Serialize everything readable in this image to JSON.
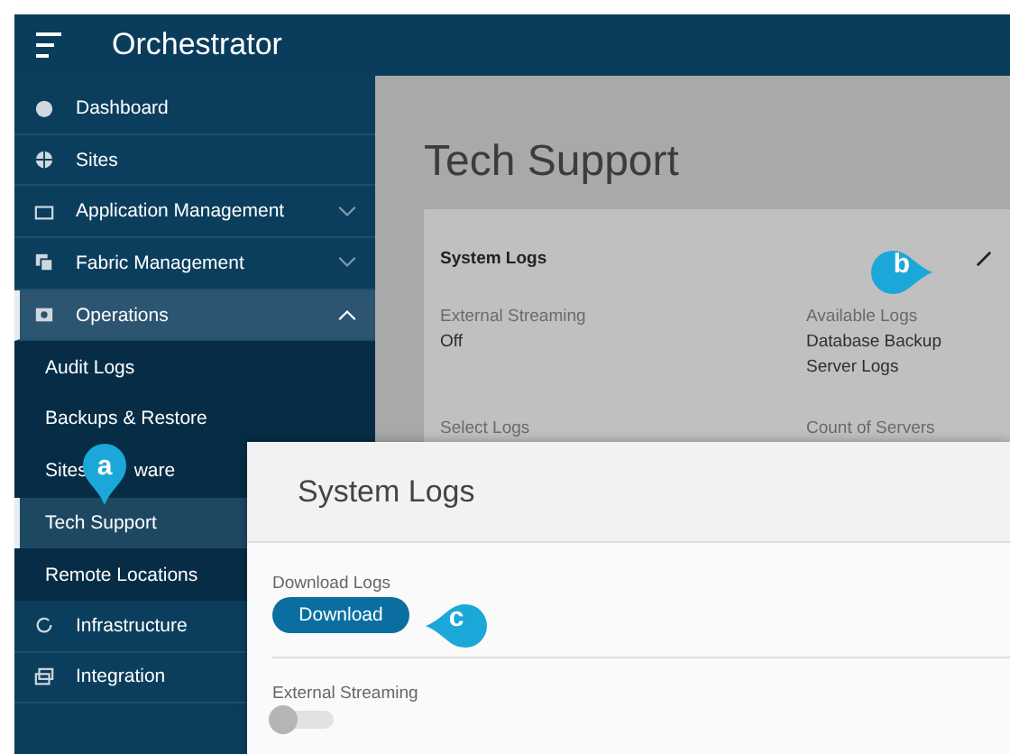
{
  "header": {
    "title": "Orchestrator"
  },
  "sidebar": {
    "items": [
      {
        "label": "Dashboard",
        "selected": false
      },
      {
        "label": "Sites",
        "selected": false
      },
      {
        "label": "Application Management",
        "selected": false,
        "expanded": false
      },
      {
        "label": "Fabric Management",
        "selected": false,
        "expanded": false
      },
      {
        "label": "Operations",
        "selected": true,
        "expanded": true,
        "children": [
          {
            "label": "Audit Logs",
            "selected": false
          },
          {
            "label": "Backups & Restore",
            "selected": false
          },
          {
            "label": "Sites",
            "label_end": "ware",
            "selected": false
          },
          {
            "label": "Tech Support",
            "selected": true
          },
          {
            "label": "Remote Locations",
            "selected": false
          }
        ]
      },
      {
        "label": "Infrastructure",
        "selected": false
      },
      {
        "label": "Integration",
        "selected": false
      }
    ]
  },
  "page": {
    "title": "Tech Support",
    "card": {
      "title": "System Logs",
      "fields": [
        {
          "label": "External Streaming",
          "values": [
            "Off"
          ]
        },
        {
          "label": "Available Logs",
          "values": [
            "Database Backup",
            "Server Logs"
          ]
        },
        {
          "label": "Select Logs"
        },
        {
          "label": "Count of Servers"
        }
      ]
    }
  },
  "dialog": {
    "title": "System Logs",
    "download_label": "Download Logs",
    "download_button": "Download",
    "streaming": {
      "label": "External Streaming",
      "on": false
    }
  },
  "callouts": [
    {
      "letter": "a"
    },
    {
      "letter": "b"
    },
    {
      "letter": "c"
    }
  ]
}
